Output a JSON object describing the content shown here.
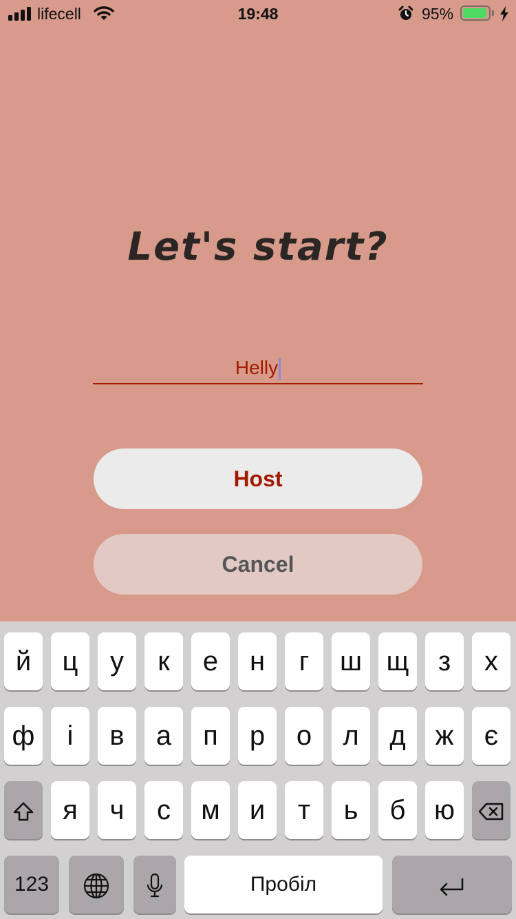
{
  "status_bar": {
    "carrier": "lifecell",
    "time": "19:48",
    "battery_percent": "95%",
    "battery_level": 0.95,
    "battery_color": "#4cd964"
  },
  "screen": {
    "title": "Let's start?",
    "name_input_value": "Helly",
    "host_button_label": "Host",
    "cancel_button_label": "Cancel",
    "accent_color": "#a11a00",
    "background_color": "#d79a8b"
  },
  "keyboard": {
    "row1": [
      "й",
      "ц",
      "у",
      "к",
      "е",
      "н",
      "г",
      "ш",
      "щ",
      "з",
      "х"
    ],
    "row2": [
      "ф",
      "і",
      "в",
      "а",
      "п",
      "р",
      "о",
      "л",
      "д",
      "ж",
      "є"
    ],
    "row3": [
      "я",
      "ч",
      "с",
      "м",
      "и",
      "т",
      "ь",
      "б",
      "ю"
    ],
    "numbers_label": "123",
    "space_label": "Пробіл",
    "icons": {
      "shift": "shift-icon",
      "delete": "backspace-icon",
      "globe": "globe-icon",
      "mic": "microphone-icon",
      "return": "return-icon"
    }
  }
}
